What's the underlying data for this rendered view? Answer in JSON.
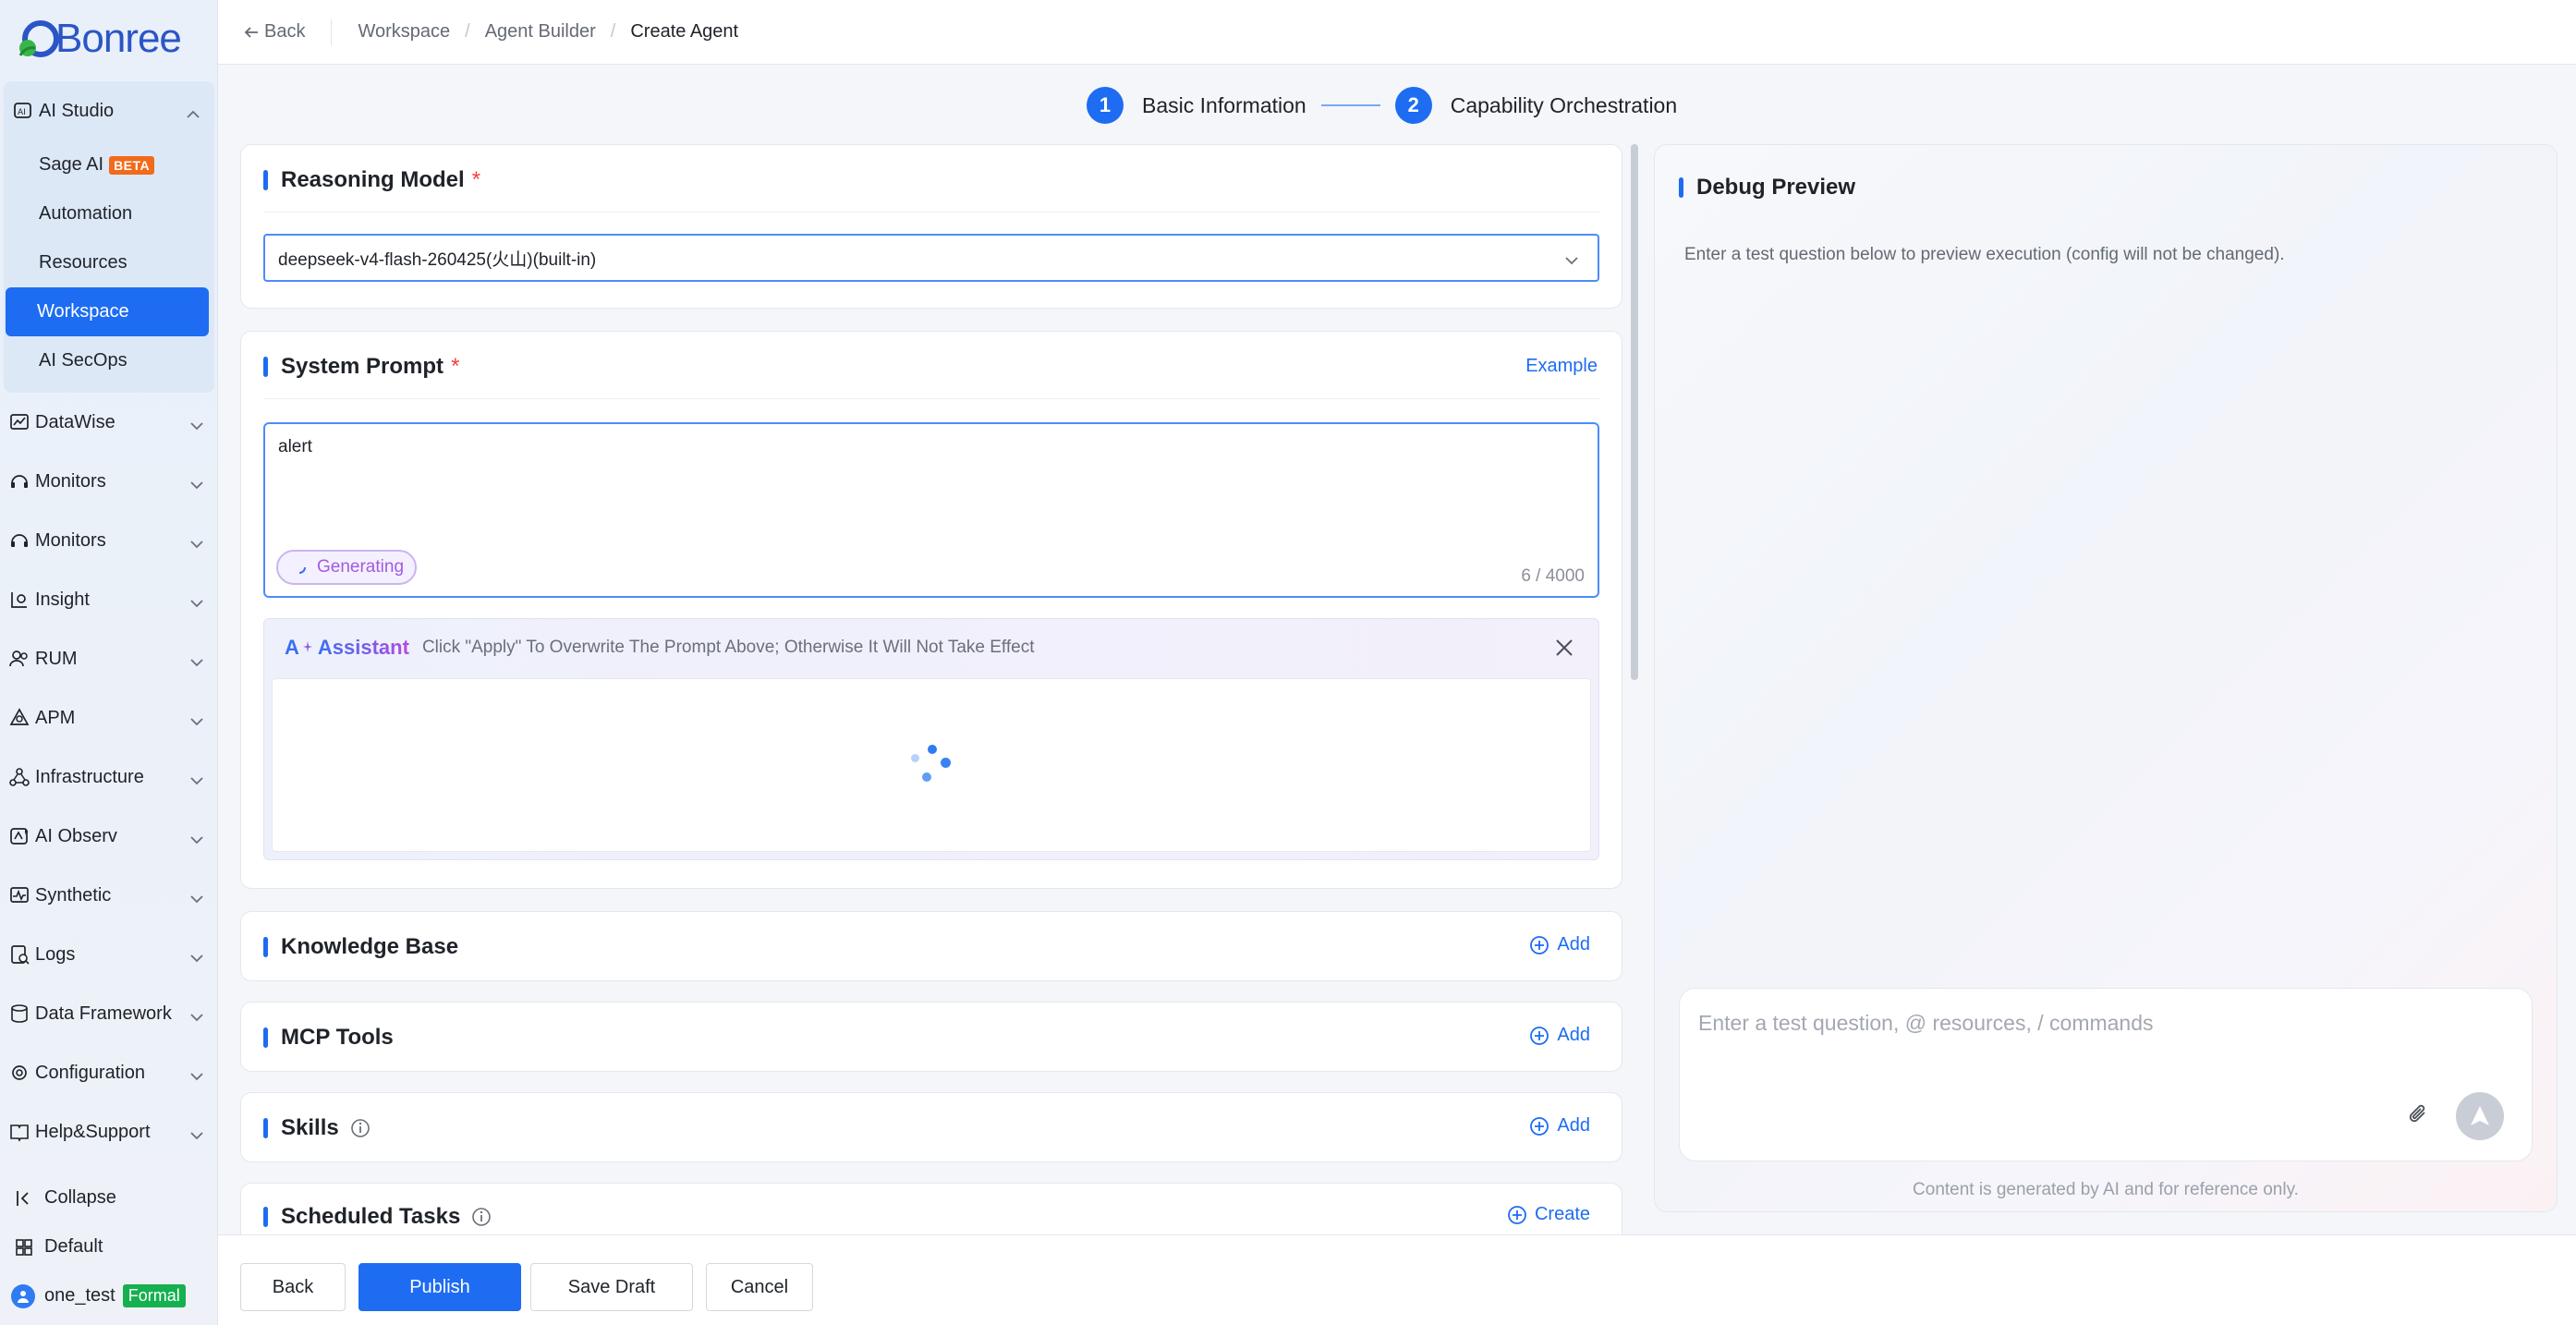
{
  "brand": {
    "name": "Bonree"
  },
  "sidebar": {
    "open_group": {
      "label": "AI Studio"
    },
    "sub_items": [
      {
        "label": "Sage AI",
        "badge": "BETA"
      },
      {
        "label": "Automation"
      },
      {
        "label": "Resources"
      },
      {
        "label": "Workspace"
      },
      {
        "label": "AI SecOps"
      }
    ],
    "groups": [
      {
        "label": "DataWise"
      },
      {
        "label": "Monitors"
      },
      {
        "label": "Monitors"
      },
      {
        "label": "Insight"
      },
      {
        "label": "RUM"
      },
      {
        "label": "APM"
      },
      {
        "label": "Infrastructure"
      },
      {
        "label": "AI Observ"
      },
      {
        "label": "Synthetic"
      },
      {
        "label": "Logs"
      },
      {
        "label": "Data Framework"
      },
      {
        "label": "Configuration"
      },
      {
        "label": "Help&Support"
      }
    ],
    "collapse_label": "Collapse",
    "org_label": "Default",
    "user": {
      "name": "one_test",
      "env": "Formal"
    }
  },
  "topbar": {
    "back_label": "Back",
    "breadcrumb": [
      "Workspace",
      "Agent Builder",
      "Create Agent"
    ]
  },
  "steps": [
    {
      "num": "1",
      "label": "Basic Information"
    },
    {
      "num": "2",
      "label": "Capability Orchestration"
    }
  ],
  "reasoning_model": {
    "title": "Reasoning Model",
    "required_mark": "*",
    "selected": "deepseek-v4-flash-260425(火山)(built-in)"
  },
  "system_prompt": {
    "title": "System Prompt",
    "required_mark": "*",
    "example_label": "Example",
    "value": "alert",
    "status": "Generating",
    "counter": "6 / 4000"
  },
  "assistant": {
    "name": "Assistant",
    "icon_text": "A",
    "hint": "Click \"Apply\" To Overwrite The Prompt Above; Otherwise It Will Not Take Effect"
  },
  "sections": [
    {
      "title": "Knowledge Base",
      "action": "Add"
    },
    {
      "title": "MCP Tools",
      "action": "Add"
    },
    {
      "title": "Skills",
      "action": "Add"
    },
    {
      "title": "Scheduled Tasks",
      "action": "Create"
    }
  ],
  "debug": {
    "title": "Debug Preview",
    "hint": "Enter a test question below to preview execution (config will not be changed).",
    "input_placeholder": "Enter a test question, @ resources, / commands",
    "disclaimer": "Content is generated by AI and for reference only."
  },
  "footer": {
    "back": "Back",
    "publish": "Publish",
    "save_draft": "Save Draft",
    "cancel": "Cancel"
  },
  "colors": {
    "accent": "#1d6cf2",
    "required": "#f53f3f",
    "beta": "#f26a1b",
    "formal": "#15b050"
  }
}
